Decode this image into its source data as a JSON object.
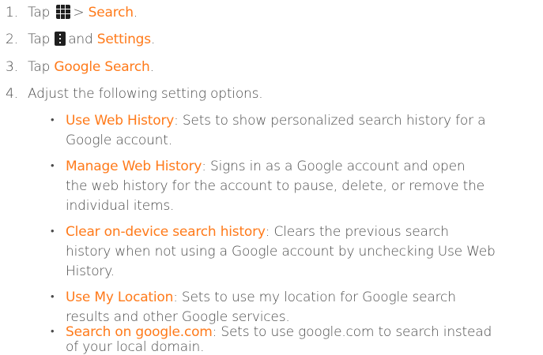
{
  "steps": [
    {
      "number": "1.",
      "prefix": "Tap",
      "icon": "apps-grid-icon",
      "separator": ">",
      "target": "Search",
      "suffix": "."
    },
    {
      "number": "2.",
      "prefix": "Tap",
      "icon": "menu-icon",
      "joiner": "and",
      "target": "Settings",
      "suffix": "."
    },
    {
      "number": "3.",
      "prefix": "Tap",
      "target": "Google Search",
      "suffix": "."
    },
    {
      "number": "4.",
      "text": "Adjust the following setting options."
    }
  ],
  "options": [
    {
      "bullet": "•",
      "title": "Use Web History",
      "lines": [
        ": Sets to show personalized search history for a",
        "Google account."
      ]
    },
    {
      "bullet": "•",
      "title": "Manage Web History",
      "lines": [
        ": Signs in as a Google account and open",
        "the web history for the account to pause, delete, or remove the",
        "individual items."
      ]
    },
    {
      "bullet": "•",
      "title": "Clear on-device search history",
      "lines": [
        ": Clears the previous search",
        "history when not using a Google account by unchecking Use Web",
        "History."
      ]
    },
    {
      "bullet": "•",
      "title": "Use My Location",
      "lines": [
        ": Sets to use my location for Google search",
        "results and other Google services."
      ]
    },
    {
      "bullet": "•",
      "title": "Search on google.com",
      "lines": [
        ": Sets to use google.com to search instead",
        "of your local domain."
      ]
    }
  ],
  "colors": {
    "highlight": "#ff7a1a",
    "body_text": "#4a4a4a",
    "icon_bg": "#1f1f1f"
  }
}
